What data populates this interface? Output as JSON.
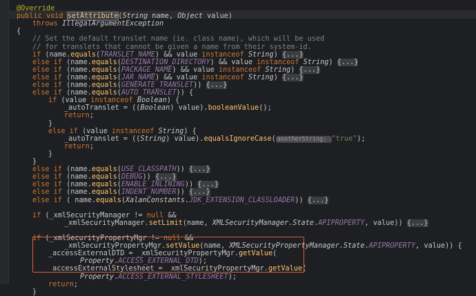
{
  "colors": {
    "background": "#1e1f22",
    "keyword": "#cc7832",
    "annotation": "#bbb529",
    "method": "#ffc66d",
    "constant": "#9876aa",
    "string": "#6a8759",
    "comment": "#808080",
    "variable": "#c8c8c8",
    "field": "#c8c8c8",
    "param": "#c8c8c8",
    "type": "#c8c8c8",
    "highlight_box": "#d9623b"
  },
  "code_lines": [
    {
      "indent": 0,
      "tokens": [
        [
          "annotation",
          "@Override"
        ]
      ]
    },
    {
      "indent": 0,
      "tokens": [
        [
          "keyword",
          "public "
        ],
        [
          "keyword",
          "void "
        ],
        [
          "method-sel",
          "setAttribute"
        ],
        [
          "plain",
          "("
        ],
        [
          "type",
          "String "
        ],
        [
          "param",
          "name"
        ],
        [
          "plain",
          ", "
        ],
        [
          "type",
          "Object "
        ],
        [
          "param",
          "value"
        ],
        [
          "plain",
          ")"
        ]
      ]
    },
    {
      "indent": 1,
      "tokens": [
        [
          "keyword",
          "throws "
        ],
        [
          "type",
          "IllegalArgumentException"
        ]
      ]
    },
    {
      "indent": 0,
      "tokens": [
        [
          "plain",
          "{"
        ]
      ]
    },
    {
      "indent": 1,
      "tokens": [
        [
          "comment",
          "// Set the default translet name (ie. class name), which will be used"
        ]
      ]
    },
    {
      "indent": 1,
      "tokens": [
        [
          "comment",
          "// for translets that cannot be given a name from their system-id."
        ]
      ]
    },
    {
      "indent": 1,
      "tokens": [
        [
          "keyword",
          "if "
        ],
        [
          "plain",
          "("
        ],
        [
          "param",
          "name"
        ],
        [
          "plain",
          "."
        ],
        [
          "method",
          "equals"
        ],
        [
          "plain",
          "("
        ],
        [
          "constant",
          "TRANSLET_NAME"
        ],
        [
          "plain",
          ") && "
        ],
        [
          "param",
          "value "
        ],
        [
          "keyword",
          "instanceof "
        ],
        [
          "type",
          "String"
        ],
        [
          "plain",
          ") "
        ],
        [
          "fold",
          "{...}"
        ]
      ]
    },
    {
      "indent": 1,
      "tokens": [
        [
          "keyword",
          "else if "
        ],
        [
          "plain",
          "("
        ],
        [
          "param",
          "name"
        ],
        [
          "plain",
          "."
        ],
        [
          "method",
          "equals"
        ],
        [
          "plain",
          "("
        ],
        [
          "constant",
          "DESTINATION_DIRECTORY"
        ],
        [
          "plain",
          ") && "
        ],
        [
          "param",
          "value "
        ],
        [
          "keyword",
          "instanceof "
        ],
        [
          "type",
          "String"
        ],
        [
          "plain",
          ") "
        ],
        [
          "fold",
          "{...}"
        ]
      ]
    },
    {
      "indent": 1,
      "tokens": [
        [
          "keyword",
          "else if "
        ],
        [
          "plain",
          "("
        ],
        [
          "param",
          "name"
        ],
        [
          "plain",
          "."
        ],
        [
          "method",
          "equals"
        ],
        [
          "plain",
          "("
        ],
        [
          "constant",
          "PACKAGE_NAME"
        ],
        [
          "plain",
          ") && "
        ],
        [
          "param",
          "value "
        ],
        [
          "keyword",
          "instanceof "
        ],
        [
          "type",
          "String"
        ],
        [
          "plain",
          ") "
        ],
        [
          "fold",
          "{...}"
        ]
      ]
    },
    {
      "indent": 1,
      "tokens": [
        [
          "keyword",
          "else if "
        ],
        [
          "plain",
          "("
        ],
        [
          "param",
          "name"
        ],
        [
          "plain",
          "."
        ],
        [
          "method",
          "equals"
        ],
        [
          "plain",
          "("
        ],
        [
          "constant",
          "JAR_NAME"
        ],
        [
          "plain",
          ") && "
        ],
        [
          "param",
          "value "
        ],
        [
          "keyword",
          "instanceof "
        ],
        [
          "type",
          "String"
        ],
        [
          "plain",
          ") "
        ],
        [
          "fold",
          "{...}"
        ]
      ]
    },
    {
      "indent": 1,
      "tokens": [
        [
          "keyword",
          "else if "
        ],
        [
          "plain",
          "("
        ],
        [
          "param",
          "name"
        ],
        [
          "plain",
          "."
        ],
        [
          "method",
          "equals"
        ],
        [
          "plain",
          "("
        ],
        [
          "constant",
          "GENERATE_TRANSLET"
        ],
        [
          "plain",
          ")) "
        ],
        [
          "fold",
          "{...}"
        ]
      ]
    },
    {
      "indent": 1,
      "tokens": [
        [
          "keyword",
          "else if "
        ],
        [
          "plain",
          "("
        ],
        [
          "param",
          "name"
        ],
        [
          "plain",
          "."
        ],
        [
          "method",
          "equals"
        ],
        [
          "plain",
          "("
        ],
        [
          "constant",
          "AUTO_TRANSLET"
        ],
        [
          "plain",
          ")) {"
        ]
      ]
    },
    {
      "indent": 2,
      "tokens": [
        [
          "keyword",
          "if "
        ],
        [
          "plain",
          "("
        ],
        [
          "param",
          "value "
        ],
        [
          "keyword",
          "instanceof "
        ],
        [
          "type",
          "Boolean"
        ],
        [
          "plain",
          ") {"
        ]
      ]
    },
    {
      "indent": 3,
      "tokens": [
        [
          "field",
          "_autoTranslet"
        ],
        [
          "plain",
          " = (("
        ],
        [
          "type",
          "Boolean"
        ],
        [
          "plain",
          ") "
        ],
        [
          "param",
          "value"
        ],
        [
          "plain",
          ")."
        ],
        [
          "method",
          "booleanValue"
        ],
        [
          "plain",
          "();"
        ]
      ]
    },
    {
      "indent": 3,
      "tokens": [
        [
          "keyword",
          "return"
        ],
        [
          "plain",
          ";"
        ]
      ]
    },
    {
      "indent": 2,
      "tokens": [
        [
          "plain",
          "}"
        ]
      ]
    },
    {
      "indent": 2,
      "tokens": [
        [
          "keyword",
          "else if "
        ],
        [
          "plain",
          "("
        ],
        [
          "param",
          "value "
        ],
        [
          "keyword",
          "instanceof "
        ],
        [
          "type",
          "String"
        ],
        [
          "plain",
          ") {"
        ]
      ]
    },
    {
      "indent": 3,
      "tokens": [
        [
          "field",
          "_autoTranslet"
        ],
        [
          "plain",
          " = (("
        ],
        [
          "type",
          "String"
        ],
        [
          "plain",
          ") "
        ],
        [
          "param",
          "value"
        ],
        [
          "plain",
          ")."
        ],
        [
          "method",
          "equalsIgnoreCase"
        ],
        [
          "plain",
          "("
        ],
        [
          "hint",
          "anotherString: "
        ],
        [
          "string",
          "\"true\""
        ],
        [
          "plain",
          ");"
        ]
      ]
    },
    {
      "indent": 3,
      "tokens": [
        [
          "keyword",
          "return"
        ],
        [
          "plain",
          ";"
        ]
      ]
    },
    {
      "indent": 2,
      "tokens": [
        [
          "plain",
          "}"
        ]
      ]
    },
    {
      "indent": 1,
      "tokens": [
        [
          "plain",
          "}"
        ]
      ]
    },
    {
      "indent": 1,
      "tokens": [
        [
          "keyword",
          "else if "
        ],
        [
          "plain",
          "("
        ],
        [
          "param",
          "name"
        ],
        [
          "plain",
          "."
        ],
        [
          "method",
          "equals"
        ],
        [
          "plain",
          "("
        ],
        [
          "constant",
          "USE_CLASSPATH"
        ],
        [
          "plain",
          ")) "
        ],
        [
          "fold",
          "{...}"
        ]
      ]
    },
    {
      "indent": 1,
      "tokens": [
        [
          "keyword",
          "else if "
        ],
        [
          "plain",
          "("
        ],
        [
          "param",
          "name"
        ],
        [
          "plain",
          "."
        ],
        [
          "method",
          "equals"
        ],
        [
          "plain",
          "("
        ],
        [
          "constant",
          "DEBUG"
        ],
        [
          "plain",
          ")) "
        ],
        [
          "fold",
          "{...}"
        ]
      ]
    },
    {
      "indent": 1,
      "tokens": [
        [
          "keyword",
          "else if "
        ],
        [
          "plain",
          "("
        ],
        [
          "param",
          "name"
        ],
        [
          "plain",
          "."
        ],
        [
          "method",
          "equals"
        ],
        [
          "plain",
          "("
        ],
        [
          "constant",
          "ENABLE_INLINING"
        ],
        [
          "plain",
          ")) "
        ],
        [
          "fold",
          "{...}"
        ]
      ]
    },
    {
      "indent": 1,
      "tokens": [
        [
          "keyword",
          "else if "
        ],
        [
          "plain",
          "("
        ],
        [
          "param",
          "name"
        ],
        [
          "plain",
          "."
        ],
        [
          "method",
          "equals"
        ],
        [
          "plain",
          "("
        ],
        [
          "constant",
          "INDENT_NUMBER"
        ],
        [
          "plain",
          ")) "
        ],
        [
          "fold",
          "{...}"
        ]
      ]
    },
    {
      "indent": 1,
      "tokens": [
        [
          "keyword",
          "else if "
        ],
        [
          "plain",
          "( "
        ],
        [
          "param",
          "name"
        ],
        [
          "plain",
          "."
        ],
        [
          "method",
          "equals"
        ],
        [
          "plain",
          "("
        ],
        [
          "type",
          "XalanConstants"
        ],
        [
          "plain",
          "."
        ],
        [
          "constant",
          "JDK_EXTENSION_CLASSLOADER"
        ],
        [
          "plain",
          ")) "
        ],
        [
          "fold",
          "{...}"
        ]
      ]
    },
    {
      "indent": 0,
      "tokens": []
    },
    {
      "indent": 1,
      "tokens": [
        [
          "keyword",
          "if "
        ],
        [
          "plain",
          "("
        ],
        [
          "field",
          "_xmlSecurityManager"
        ],
        [
          "plain",
          " != "
        ],
        [
          "keyword",
          "null "
        ],
        [
          "plain",
          "&&"
        ]
      ]
    },
    {
      "indent": 3,
      "tokens": [
        [
          "field",
          "_xmlSecurityManager"
        ],
        [
          "plain",
          "."
        ],
        [
          "method",
          "setLimit"
        ],
        [
          "plain",
          "("
        ],
        [
          "param",
          "name"
        ],
        [
          "plain",
          ", "
        ],
        [
          "type",
          "XMLSecurityManager.State"
        ],
        [
          "plain",
          "."
        ],
        [
          "constant",
          "APIPROPERTY"
        ],
        [
          "plain",
          ", "
        ],
        [
          "param",
          "value"
        ],
        [
          "plain",
          ")) "
        ],
        [
          "fold",
          "{...}"
        ]
      ]
    },
    {
      "indent": 0,
      "tokens": []
    },
    {
      "indent": 1,
      "tokens": [
        [
          "keyword",
          "if "
        ],
        [
          "plain",
          "("
        ],
        [
          "field",
          "_xmlSecurityPropertyMgr"
        ],
        [
          "plain",
          " != "
        ],
        [
          "keyword",
          "null "
        ],
        [
          "plain",
          "&&"
        ]
      ]
    },
    {
      "indent": 3,
      "tokens": [
        [
          "field",
          "_xmlSecurityPropertyMgr"
        ],
        [
          "plain",
          "."
        ],
        [
          "method",
          "setValue"
        ],
        [
          "plain",
          "("
        ],
        [
          "param",
          "name"
        ],
        [
          "plain",
          ", "
        ],
        [
          "type",
          "XMLSecurityPropertyManager.State"
        ],
        [
          "plain",
          "."
        ],
        [
          "constant",
          "APIPROPERTY"
        ],
        [
          "plain",
          ", "
        ],
        [
          "param",
          "value"
        ],
        [
          "plain",
          ")) {"
        ]
      ]
    },
    {
      "indent": 2,
      "tokens": [
        [
          "field",
          "_accessExternalDTD"
        ],
        [
          "plain",
          " = "
        ],
        [
          "field",
          "_xmlSecurityPropertyMgr"
        ],
        [
          "plain",
          "."
        ],
        [
          "method",
          "getValue"
        ],
        [
          "plain",
          "("
        ]
      ]
    },
    {
      "indent": 4,
      "tokens": [
        [
          "type",
          "Property"
        ],
        [
          "plain",
          "."
        ],
        [
          "constant",
          "ACCESS_EXTERNAL_DTD"
        ],
        [
          "plain",
          ");"
        ]
      ]
    },
    {
      "indent": 2,
      "tokens": [
        [
          "field",
          "_accessExternalStylesheet"
        ],
        [
          "plain",
          " = "
        ],
        [
          "field",
          "_xmlSecurityPropertyMgr"
        ],
        [
          "plain",
          "."
        ],
        [
          "method",
          "getValue"
        ],
        [
          "plain",
          "("
        ]
      ]
    },
    {
      "indent": 4,
      "tokens": [
        [
          "type",
          "Property"
        ],
        [
          "plain",
          "."
        ],
        [
          "constant",
          "ACCESS_EXTERNAL_STYLESHEET"
        ],
        [
          "plain",
          ");"
        ]
      ]
    },
    {
      "indent": 2,
      "tokens": [
        [
          "keyword",
          "return"
        ],
        [
          "plain",
          ";"
        ]
      ]
    },
    {
      "indent": 1,
      "tokens": [
        [
          "plain",
          "}"
        ]
      ]
    }
  ]
}
